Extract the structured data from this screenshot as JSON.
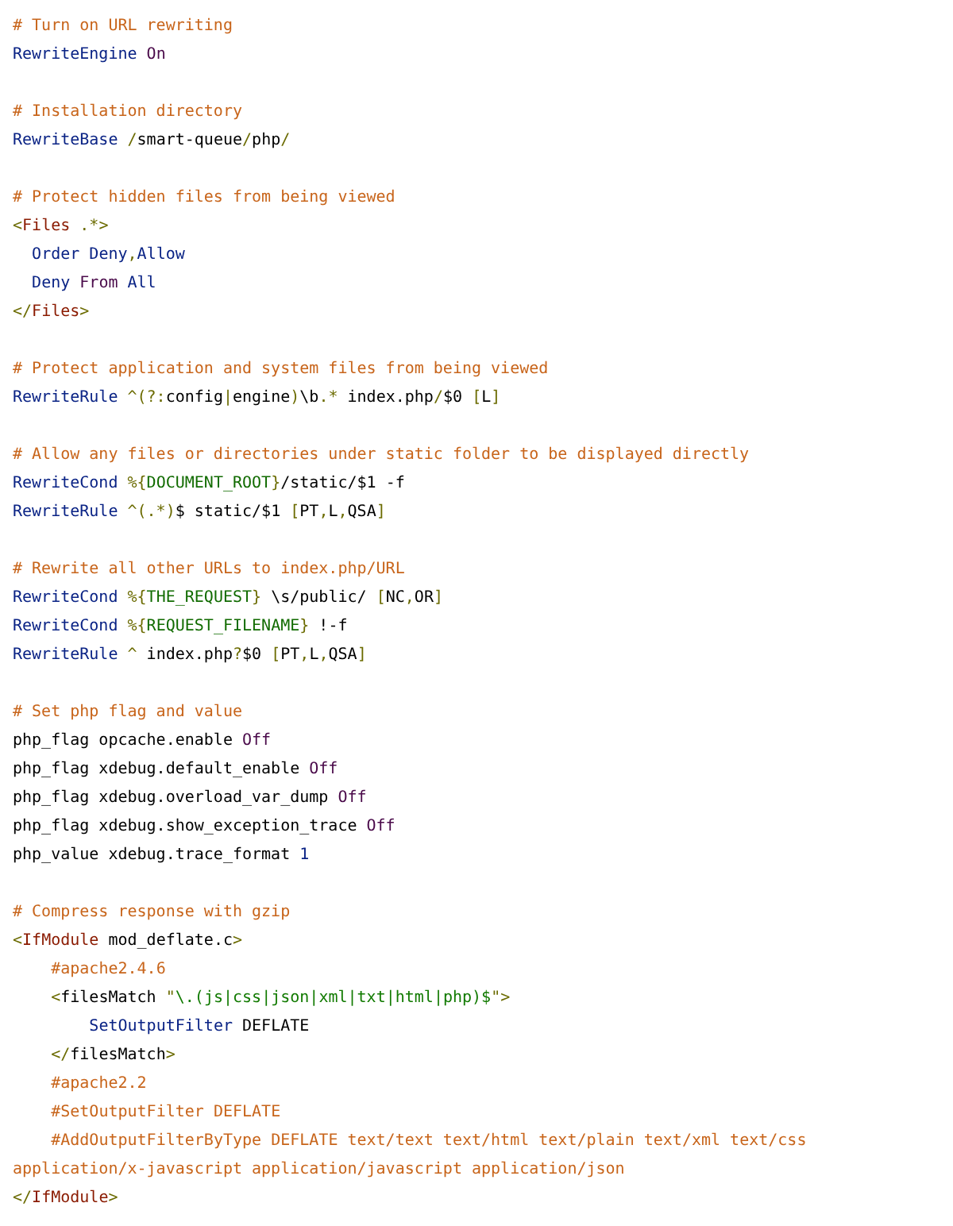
{
  "blocks": [
    {
      "lines": [
        {
          "tokens": [
            {
              "kind": "comment",
              "text": "# Turn on URL rewriting"
            }
          ]
        },
        {
          "tokens": [
            {
              "kind": "directive",
              "text": "RewriteEngine "
            },
            {
              "kind": "keyword",
              "text": "On"
            }
          ]
        }
      ]
    },
    {
      "lines": [
        {
          "tokens": [
            {
              "kind": "comment",
              "text": "# Installation directory"
            }
          ]
        },
        {
          "tokens": [
            {
              "kind": "directive",
              "text": "RewriteBase "
            },
            {
              "kind": "punct",
              "text": "/"
            },
            {
              "kind": "plain",
              "text": "smart-queue"
            },
            {
              "kind": "punct",
              "text": "/"
            },
            {
              "kind": "plain",
              "text": "php"
            },
            {
              "kind": "punct",
              "text": "/"
            }
          ]
        }
      ]
    },
    {
      "lines": [
        {
          "tokens": [
            {
              "kind": "comment",
              "text": "# Protect hidden files from being viewed"
            }
          ]
        },
        {
          "tokens": [
            {
              "kind": "punct",
              "text": "<"
            },
            {
              "kind": "tag",
              "text": "Files "
            },
            {
              "kind": "punct",
              "text": ".*>"
            }
          ]
        },
        {
          "tokens": [
            {
              "kind": "directive",
              "text": "  Order Deny"
            },
            {
              "kind": "punct",
              "text": ","
            },
            {
              "kind": "directive",
              "text": "Allow"
            }
          ]
        },
        {
          "tokens": [
            {
              "kind": "directive",
              "text": "  Deny "
            },
            {
              "kind": "keyword",
              "text": "From "
            },
            {
              "kind": "directive",
              "text": "All"
            }
          ]
        },
        {
          "tokens": [
            {
              "kind": "punct",
              "text": "</"
            },
            {
              "kind": "tag",
              "text": "Files"
            },
            {
              "kind": "punct",
              "text": ">"
            }
          ]
        }
      ]
    },
    {
      "lines": [
        {
          "tokens": [
            {
              "kind": "comment",
              "text": "# Protect application and system files from being viewed"
            }
          ]
        },
        {
          "tokens": [
            {
              "kind": "directive",
              "text": "RewriteRule "
            },
            {
              "kind": "punct",
              "text": "^(?:"
            },
            {
              "kind": "plain",
              "text": "config"
            },
            {
              "kind": "punct",
              "text": "|"
            },
            {
              "kind": "plain",
              "text": "engine"
            },
            {
              "kind": "punct",
              "text": ")"
            },
            {
              "kind": "plain",
              "text": "\\b"
            },
            {
              "kind": "punct",
              "text": ".*"
            },
            {
              "kind": "plain",
              "text": " index.php"
            },
            {
              "kind": "punct",
              "text": "/"
            },
            {
              "kind": "plain",
              "text": "$0 "
            },
            {
              "kind": "punct",
              "text": "["
            },
            {
              "kind": "plain",
              "text": "L"
            },
            {
              "kind": "punct",
              "text": "]"
            }
          ]
        }
      ]
    },
    {
      "lines": [
        {
          "tokens": [
            {
              "kind": "comment",
              "text": "# Allow any files or directories under static folder to be displayed directly"
            }
          ]
        },
        {
          "tokens": [
            {
              "kind": "directive",
              "text": "RewriteCond "
            },
            {
              "kind": "punct",
              "text": "%{"
            },
            {
              "kind": "variable",
              "text": "DOCUMENT_ROOT"
            },
            {
              "kind": "punct",
              "text": "}"
            },
            {
              "kind": "plain",
              "text": "/static/$1 -f"
            }
          ]
        },
        {
          "tokens": [
            {
              "kind": "directive",
              "text": "RewriteRule "
            },
            {
              "kind": "punct",
              "text": "^(.*)"
            },
            {
              "kind": "plain",
              "text": "$ static/$1 "
            },
            {
              "kind": "punct",
              "text": "["
            },
            {
              "kind": "plain",
              "text": "PT"
            },
            {
              "kind": "punct",
              "text": ","
            },
            {
              "kind": "plain",
              "text": "L"
            },
            {
              "kind": "punct",
              "text": ","
            },
            {
              "kind": "plain",
              "text": "QSA"
            },
            {
              "kind": "punct",
              "text": "]"
            }
          ]
        }
      ]
    },
    {
      "lines": [
        {
          "tokens": [
            {
              "kind": "comment",
              "text": "# Rewrite all other URLs to index.php/URL"
            }
          ]
        },
        {
          "tokens": [
            {
              "kind": "directive",
              "text": "RewriteCond "
            },
            {
              "kind": "punct",
              "text": "%{"
            },
            {
              "kind": "variable",
              "text": "THE_REQUEST"
            },
            {
              "kind": "punct",
              "text": "}"
            },
            {
              "kind": "plain",
              "text": " \\s/public/ "
            },
            {
              "kind": "punct",
              "text": "["
            },
            {
              "kind": "plain",
              "text": "NC"
            },
            {
              "kind": "punct",
              "text": ","
            },
            {
              "kind": "plain",
              "text": "OR"
            },
            {
              "kind": "punct",
              "text": "]"
            }
          ]
        },
        {
          "tokens": [
            {
              "kind": "directive",
              "text": "RewriteCond "
            },
            {
              "kind": "punct",
              "text": "%{"
            },
            {
              "kind": "variable",
              "text": "REQUEST_FILENAME"
            },
            {
              "kind": "punct",
              "text": "}"
            },
            {
              "kind": "plain",
              "text": " !-f"
            }
          ]
        },
        {
          "tokens": [
            {
              "kind": "directive",
              "text": "RewriteRule "
            },
            {
              "kind": "punct",
              "text": "^"
            },
            {
              "kind": "plain",
              "text": " index.php"
            },
            {
              "kind": "punct",
              "text": "?"
            },
            {
              "kind": "plain",
              "text": "$0 "
            },
            {
              "kind": "punct",
              "text": "["
            },
            {
              "kind": "plain",
              "text": "PT"
            },
            {
              "kind": "punct",
              "text": ","
            },
            {
              "kind": "plain",
              "text": "L"
            },
            {
              "kind": "punct",
              "text": ","
            },
            {
              "kind": "plain",
              "text": "QSA"
            },
            {
              "kind": "punct",
              "text": "]"
            }
          ]
        }
      ]
    },
    {
      "lines": [
        {
          "tokens": [
            {
              "kind": "comment",
              "text": "# Set php flag and value"
            }
          ]
        },
        {
          "tokens": [
            {
              "kind": "plain",
              "text": "php_flag opcache.enable "
            },
            {
              "kind": "keyword",
              "text": "Off"
            }
          ]
        },
        {
          "tokens": [
            {
              "kind": "plain",
              "text": "php_flag xdebug.default_enable "
            },
            {
              "kind": "keyword",
              "text": "Off"
            }
          ]
        },
        {
          "tokens": [
            {
              "kind": "plain",
              "text": "php_flag xdebug.overload_var_dump "
            },
            {
              "kind": "keyword",
              "text": "Off"
            }
          ]
        },
        {
          "tokens": [
            {
              "kind": "plain",
              "text": "php_flag xdebug.show_exception_trace "
            },
            {
              "kind": "keyword",
              "text": "Off"
            }
          ]
        },
        {
          "tokens": [
            {
              "kind": "plain",
              "text": "php_value xdebug.trace_format "
            },
            {
              "kind": "number",
              "text": "1"
            }
          ]
        }
      ]
    },
    {
      "lines": [
        {
          "tokens": [
            {
              "kind": "comment",
              "text": "# Compress response with gzip"
            }
          ]
        },
        {
          "tokens": [
            {
              "kind": "punct",
              "text": "<"
            },
            {
              "kind": "tag",
              "text": "IfModule"
            },
            {
              "kind": "plain",
              "text": " mod_deflate.c"
            },
            {
              "kind": "punct",
              "text": ">"
            }
          ]
        },
        {
          "tokens": [
            {
              "kind": "comment",
              "text": "    #apache2.4.6"
            }
          ]
        },
        {
          "tokens": [
            {
              "kind": "punct",
              "text": "    <"
            },
            {
              "kind": "plain",
              "text": "filesMatch "
            },
            {
              "kind": "punct",
              "text": "\""
            },
            {
              "kind": "string",
              "text": "\\.(js|css|json|xml|txt|html|php)$"
            },
            {
              "kind": "punct",
              "text": "\">"
            }
          ]
        },
        {
          "tokens": [
            {
              "kind": "directive",
              "text": "        SetOutputFilter"
            },
            {
              "kind": "plain",
              "text": " DEFLATE"
            }
          ]
        },
        {
          "tokens": [
            {
              "kind": "punct",
              "text": "    </"
            },
            {
              "kind": "plain",
              "text": "filesMatch"
            },
            {
              "kind": "punct",
              "text": ">"
            }
          ]
        },
        {
          "tokens": [
            {
              "kind": "comment",
              "text": "    #apache2.2"
            }
          ]
        },
        {
          "tokens": [
            {
              "kind": "comment",
              "text": "    #SetOutputFilter DEFLATE"
            }
          ]
        },
        {
          "tokens": [
            {
              "kind": "comment",
              "text": "    #AddOutputFilterByType DEFLATE text/text text/html text/plain text/xml text/css application/x-javascript application/javascript application/json"
            }
          ]
        },
        {
          "tokens": [
            {
              "kind": "punct",
              "text": "</"
            },
            {
              "kind": "tag",
              "text": "IfModule"
            },
            {
              "kind": "punct",
              "text": ">"
            }
          ]
        }
      ]
    }
  ]
}
